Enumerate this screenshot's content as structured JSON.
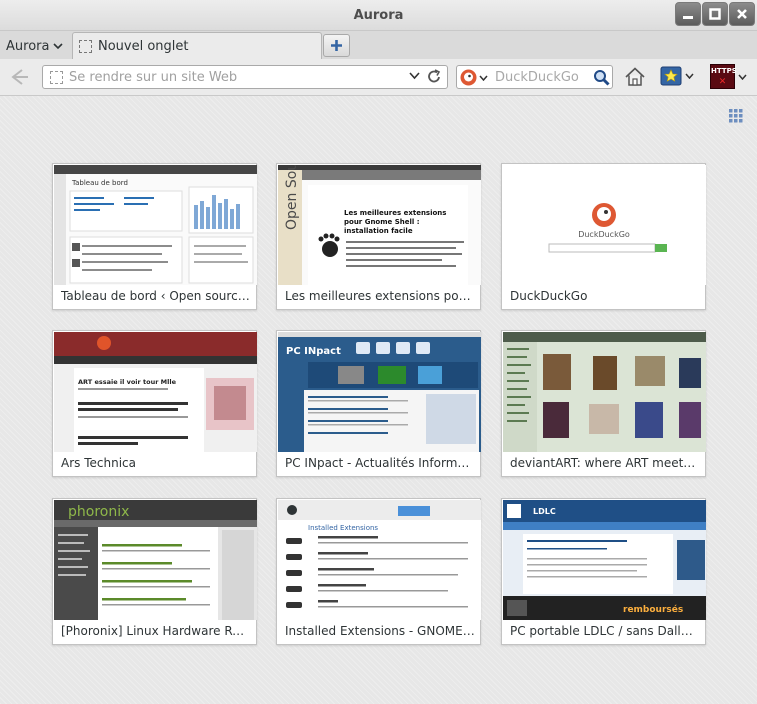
{
  "window": {
    "title": "Aurora"
  },
  "tabstrip": {
    "app_menu_label": "Aurora",
    "tabs": [
      {
        "label": "Nouvel onglet"
      }
    ]
  },
  "navbar": {
    "url_placeholder": "Se rendre sur un site Web",
    "search_placeholder": "DuckDuckGo",
    "https_label_line1": "HTTPS",
    "https_label_line2": "✕"
  },
  "tiles": [
    {
      "title": "Tableau de bord ‹ Open source — ...",
      "thumb": "wordpress"
    },
    {
      "title": "Les meilleures extensions pour Gno...",
      "thumb": "opensource"
    },
    {
      "title": "DuckDuckGo",
      "thumb": "ddg"
    },
    {
      "title": "Ars Technica",
      "thumb": "ars"
    },
    {
      "title": "PC INpact - Actualités Informatique",
      "thumb": "pcinpact"
    },
    {
      "title": "deviantART: where ART meets appli...",
      "thumb": "deviantart"
    },
    {
      "title": "[Phoronix] Linux Hardware Reviews...",
      "thumb": "phoronix"
    },
    {
      "title": "Installed Extensions - GNOME Shell...",
      "thumb": "gnome"
    },
    {
      "title": "PC portable LDLC / sans Dalle bril...",
      "thumb": "ldlc"
    }
  ],
  "thumb_text": {
    "wordpress_heading": "Tableau de bord",
    "opensource_side": "Open Source",
    "opensource_headline": "Les meilleures extensions pour Gnome Shell : installation facile",
    "ddg_wordmark": "DuckDuckGo",
    "ars_headline": "ART essaie il voir tour Mlle",
    "pcinpact_logo": "PC INpact",
    "phoronix_logo": "phoronix",
    "gnome_heading": "Installed Extensions",
    "ldlc_logo": "LDLC",
    "ldlc_promo": "remboursés"
  },
  "colors": {
    "accent_blue": "#3465a4",
    "ddg_orange": "#de5833",
    "https_red": "#5a0a12"
  }
}
